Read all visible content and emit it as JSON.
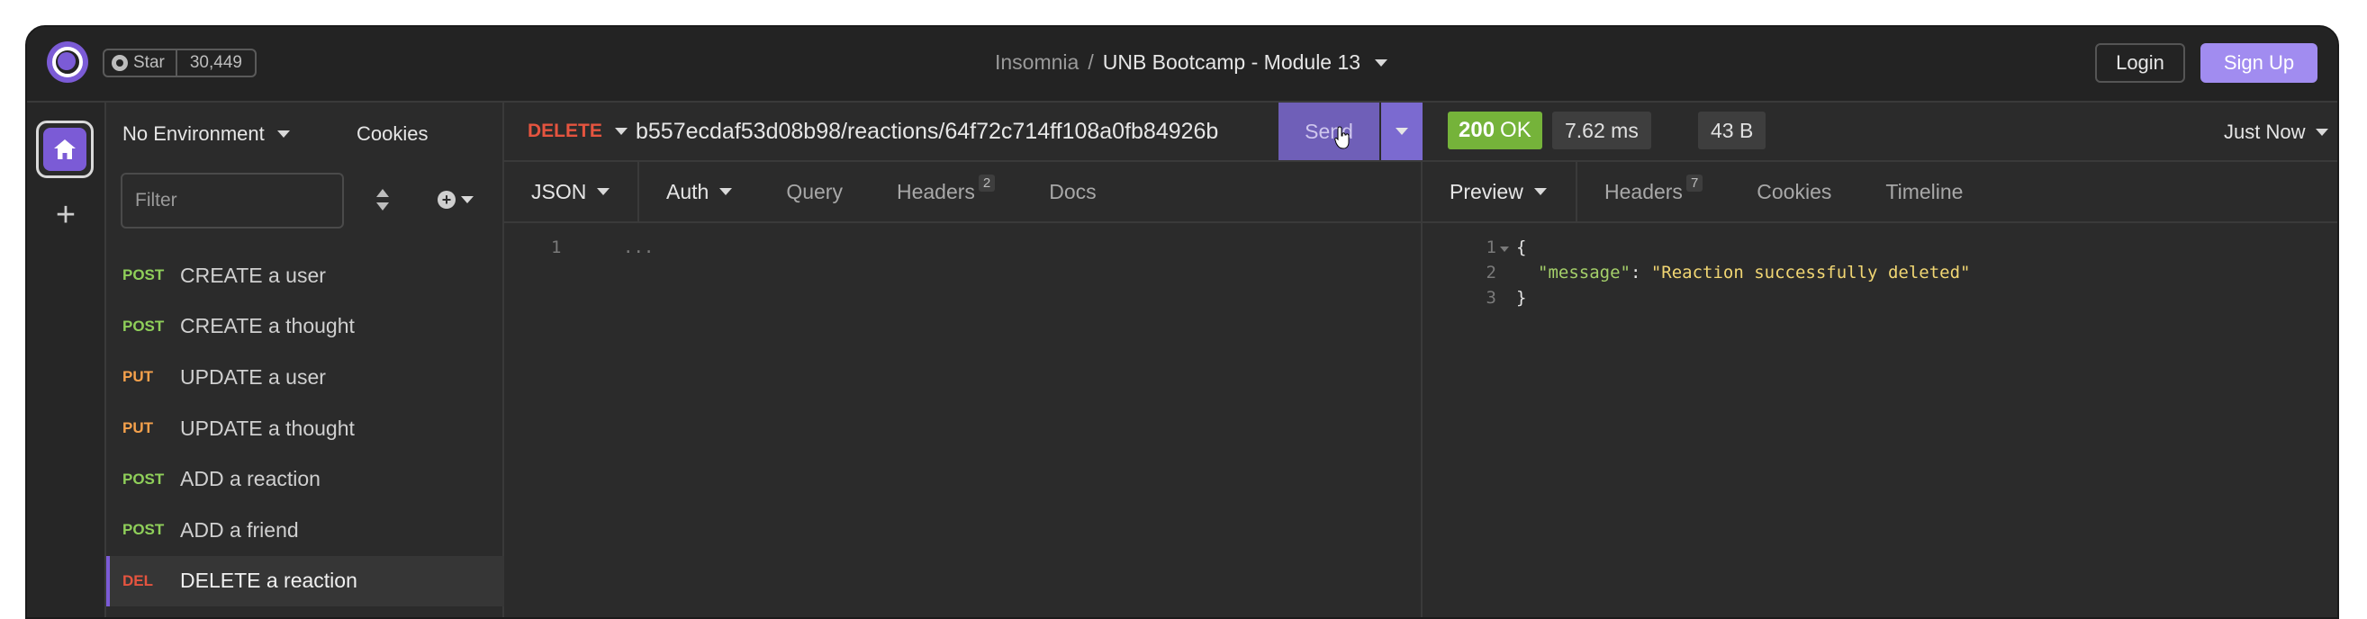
{
  "topbar": {
    "github": {
      "star_label": "Star",
      "star_count": "30,449"
    },
    "breadcrumb": {
      "app": "Insomnia",
      "separator": "/",
      "project": "UNB Bootcamp - Module 13"
    },
    "login_label": "Login",
    "signup_label": "Sign Up"
  },
  "sidebar": {
    "environment": "No Environment",
    "cookies_label": "Cookies",
    "filter_placeholder": "Filter",
    "requests": [
      {
        "method": "POST",
        "name": "CREATE a user"
      },
      {
        "method": "POST",
        "name": "CREATE a thought"
      },
      {
        "method": "PUT",
        "name": "UPDATE a user"
      },
      {
        "method": "PUT",
        "name": "UPDATE a thought"
      },
      {
        "method": "POST",
        "name": "ADD a reaction"
      },
      {
        "method": "POST",
        "name": "ADD a friend"
      },
      {
        "method": "DEL",
        "name": "DELETE a reaction"
      }
    ]
  },
  "request": {
    "method": "DELETE",
    "url": "b557ecdaf53d08b98/reactions/64f72c714ff108a0fb84926b",
    "send_label": "Send",
    "tabs": {
      "body": "JSON",
      "auth": "Auth",
      "query": "Query",
      "headers": "Headers",
      "headers_count": "2",
      "docs": "Docs"
    },
    "editor": {
      "line_1": "1",
      "line_1_text": "..."
    }
  },
  "response": {
    "status_code": "200",
    "status_text": "OK",
    "time": "7.62 ms",
    "size": "43 B",
    "when": "Just Now",
    "tabs": {
      "preview": "Preview",
      "headers": "Headers",
      "headers_count": "7",
      "cookies": "Cookies",
      "timeline": "Timeline"
    },
    "body": {
      "line_numbers": [
        "1",
        "2",
        "3"
      ],
      "open_brace": "{",
      "key": "\"message\"",
      "colon": ": ",
      "value": "\"Reaction successfully deleted\"",
      "close_brace": "}"
    }
  },
  "colors": {
    "accent": "#7b5bd6",
    "post": "#8fcf5a",
    "put": "#f5a14c",
    "delete": "#e5543f",
    "status_ok": "#75b33a"
  }
}
